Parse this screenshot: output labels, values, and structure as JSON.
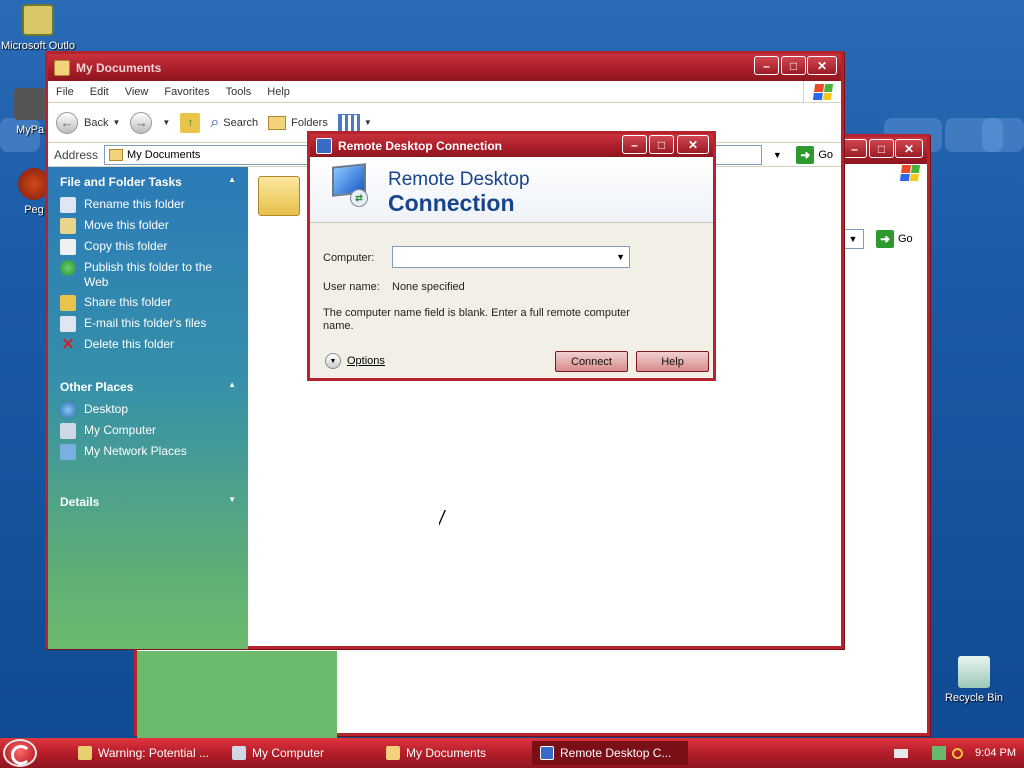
{
  "colors": {
    "window_border": "#b5232e",
    "titlebar": "#a81d28",
    "taskbar": "#b51e2a",
    "taskpane_top": "#2b7ab8",
    "taskpane_bottom": "#6cbb6c",
    "dialog_accent": "#18448c"
  },
  "desktop": {
    "icons": [
      {
        "label": "Microsoft Outlo",
        "icon": "outlook-icon"
      },
      {
        "label": "MyPa",
        "icon": "shortcut-icon"
      },
      {
        "label": "Peg",
        "icon": "app-icon"
      },
      {
        "label": "Recycle Bin",
        "icon": "recycle-bin-icon"
      }
    ]
  },
  "explorer": {
    "title": "My Documents",
    "menu": [
      "File",
      "Edit",
      "View",
      "Favorites",
      "Tools",
      "Help"
    ],
    "toolbar": {
      "back": "Back",
      "search": "Search",
      "folders": "Folders"
    },
    "address": {
      "label": "Address",
      "value": "My Documents",
      "go": "Go"
    },
    "tasks": {
      "title": "File and Folder Tasks",
      "items": [
        "Rename this folder",
        "Move this folder",
        "Copy this folder",
        "Publish this folder to the Web",
        "Share this folder",
        "E-mail this folder's files",
        "Delete this folder"
      ]
    },
    "other_places": {
      "title": "Other Places",
      "items": [
        "Desktop",
        "My Computer",
        "My Network Places"
      ]
    },
    "details": {
      "title": "Details"
    }
  },
  "back_window": {
    "go": "Go"
  },
  "dialog": {
    "title": "Remote Desktop Connection",
    "banner_line1": "Remote Desktop",
    "banner_line2": "Connection",
    "computer_label": "Computer:",
    "computer_value": "",
    "username_label": "User name:",
    "username_value": "None specified",
    "message": "The computer name field is blank. Enter a full remote computer name.",
    "options": "Options",
    "connect": "Connect",
    "help": "Help"
  },
  "taskbar": {
    "tasks": [
      "Warning: Potential ...",
      "My Computer",
      "My Documents",
      "Remote Desktop C..."
    ],
    "active_task": "Remote Desktop C...",
    "clock": "9:04 PM"
  }
}
